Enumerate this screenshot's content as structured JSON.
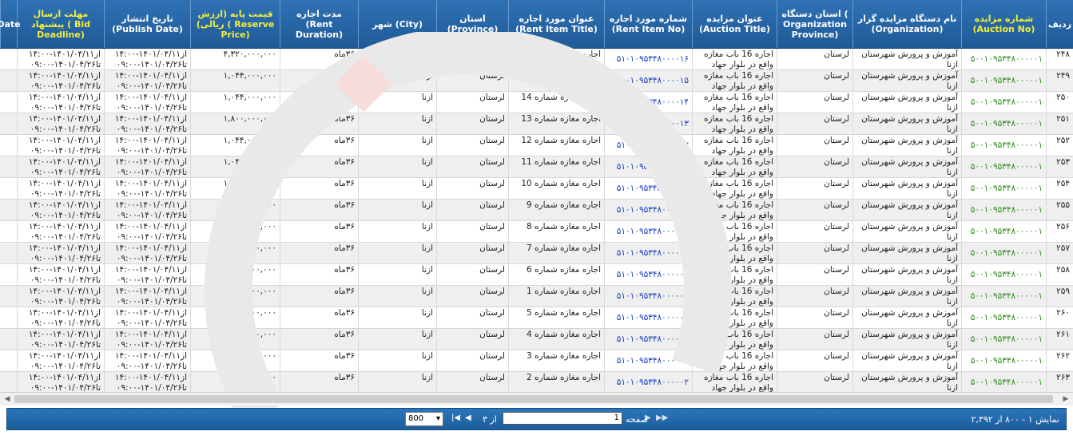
{
  "columns": [
    {
      "key": "row",
      "label": "ردیف"
    },
    {
      "key": "auction_no",
      "label": "شماره مزایده (Auction No)"
    },
    {
      "key": "org",
      "label": "نام دستگاه مزایده گزار (Organization)"
    },
    {
      "key": "org_province",
      "label": "استان دستگاه ( Organization Province)"
    },
    {
      "key": "auction_title",
      "label": "عنوان مزایده (Auction Title)"
    },
    {
      "key": "rent_item_no",
      "label": "شماره مورد اجاره (Rent Item No)"
    },
    {
      "key": "rent_item_title",
      "label": "عنوان مورد اجاره (Rent Item Title)"
    },
    {
      "key": "province",
      "label": "استان (Province)"
    },
    {
      "key": "city",
      "label": "شهر (City)"
    },
    {
      "key": "duration",
      "label": "مدت اجاره (Rent Duration)"
    },
    {
      "key": "price",
      "label": "قیمت پایه (ارزش ریالی) ( Reserve Price)"
    },
    {
      "key": "publish",
      "label": "تاریخ انتشار (Publish Date)"
    },
    {
      "key": "deadline",
      "label": "مهلت ارسال پیشنهاد ( Bid Deadline)"
    },
    {
      "key": "extra",
      "label": "Date"
    }
  ],
  "rows": [
    {
      "row": "۲۴۸",
      "auction_no": "۵۰۰۱۰۹۵۳۴۸۰۰۰۰۰۱",
      "org": "آموزش و پرورش شهرستان ازنا",
      "org_province": "لرستان",
      "auction_title": "اجاره 16 باب مغازه واقع در بلوار جهاد",
      "rent_item_no": "۵۱۰۱۰۹۵۳۴۸۰۰۰۰۱۶",
      "rent_item_title": "اجاره مغازه شماره 16",
      "province": "لرستان",
      "city": "ازنا",
      "duration": "۳۶ماه",
      "price": "۴,۳۲۰,۰۰۰,۰۰۰",
      "publish": "از۱۴۰۱/۰۴/۱۱-۱۴:۰۰ تا۱۴۰۱/۰۴/۲۶-۰۹:۰۰",
      "deadline": "از۱۴۰۱/۰۴/۱۱-۱۴:۰۰ تا۱۴۰۱/۰۴/۲۶-۰۹:۰۰"
    },
    {
      "row": "۲۴۹",
      "auction_no": "۵۰۰۱۰۹۵۳۴۸۰۰۰۰۰۱",
      "org": "آموزش و پرورش شهرستان ازنا",
      "org_province": "لرستان",
      "auction_title": "اجاره 16 باب مغازه واقع در بلوار جهاد",
      "rent_item_no": "۵۱۰۱۰۹۵۳۴۸۰۰۰۰۱۵",
      "rent_item_title": "اجاره مغازه شماره 15",
      "province": "لرستان",
      "city": "ازنا",
      "duration": "۳۶ماه",
      "price": "۱,۰۴۴,۰۰۰,۰۰۰",
      "publish": "از۱۴۰۱/۰۴/۱۱-۱۴:۰۰ تا۱۴۰۱/۰۴/۲۶-۰۹:۰۰",
      "deadline": "از۱۴۰۱/۰۴/۱۱-۱۴:۰۰ تا۱۴۰۱/۰۴/۲۶-۰۹:۰۰"
    },
    {
      "row": "۲۵۰",
      "auction_no": "۵۰۰۱۰۹۵۳۴۸۰۰۰۰۰۱",
      "org": "آموزش و پرورش شهرستان ازنا",
      "org_province": "لرستان",
      "auction_title": "اجاره 16 باب مغازه واقع در بلوار جهاد",
      "rent_item_no": "۵۱۰۱۰۹۵۳۴۸۰۰۰۰۱۴",
      "rent_item_title": "اجاره مغازه شماره 14",
      "province": "لرستان",
      "city": "ازنا",
      "duration": "۳۶ماه",
      "price": "۱,۰۴۴,۰۰۰,۰۰۰",
      "publish": "از۱۴۰۱/۰۴/۱۱-۱۴:۰۰ تا۱۴۰۱/۰۴/۲۶-۰۹:۰۰",
      "deadline": "از۱۴۰۱/۰۴/۱۱-۱۴:۰۰ تا۱۴۰۱/۰۴/۲۶-۰۹:۰۰"
    },
    {
      "row": "۲۵۱",
      "auction_no": "۵۰۰۱۰۹۵۳۴۸۰۰۰۰۰۱",
      "org": "آموزش و پرورش شهرستان ازنا",
      "org_province": "لرستان",
      "auction_title": "اجاره 16 باب مغازه واقع در بلوار جهاد",
      "rent_item_no": "۵۱۰۱۰۹۵۳۴۸۰۰۰۰۱۳",
      "rent_item_title": "اجاره مغازه شماره 13",
      "province": "لرستان",
      "city": "ازنا",
      "duration": "۳۶ماه",
      "price": "۱,۸۰۰,۰۰۰,۰۰۰",
      "publish": "از۱۴۰۱/۰۴/۱۱-۱۴:۰۰ تا۱۴۰۱/۰۴/۲۶-۰۹:۰۰",
      "deadline": "از۱۴۰۱/۰۴/۱۱-۱۴:۰۰ تا۱۴۰۱/۰۴/۲۶-۰۹:۰۰"
    },
    {
      "row": "۲۵۲",
      "auction_no": "۵۰۰۱۰۹۵۳۴۸۰۰۰۰۰۱",
      "org": "آموزش و پرورش شهرستان ازنا",
      "org_province": "لرستان",
      "auction_title": "اجاره 16 باب مغازه واقع در بلوار جهاد",
      "rent_item_no": "۵۱۰۱۰۹۵۳۴۸۰۰۰۰۱۲",
      "rent_item_title": "اجاره مغازه شماره 12",
      "province": "لرستان",
      "city": "ازنا",
      "duration": "۳۶ماه",
      "price": "۱,۰۴۴,۰۰۰,۰۰۰",
      "publish": "از۱۴۰۱/۰۴/۱۱-۱۴:۰۰ تا۱۴۰۱/۰۴/۲۶-۰۹:۰۰",
      "deadline": "از۱۴۰۱/۰۴/۱۱-۱۴:۰۰ تا۱۴۰۱/۰۴/۲۶-۰۹:۰۰"
    },
    {
      "row": "۲۵۳",
      "auction_no": "۵۰۰۱۰۹۵۳۴۸۰۰۰۰۰۱",
      "org": "آموزش و پرورش شهرستان ازنا",
      "org_province": "لرستان",
      "auction_title": "اجاره 16 باب مغازه واقع در بلوار جهاد",
      "rent_item_no": "۵۱۰۱۰۹۵۳۴۸۰۰۰۰۱۱",
      "rent_item_title": "اجاره مغازه شماره 11",
      "province": "لرستان",
      "city": "ازنا",
      "duration": "۳۶ماه",
      "price": "۱,۰۴۴,۰۰۰,۰۰۰",
      "publish": "از۱۴۰۱/۰۴/۱۱-۱۴:۰۰ تا۱۴۰۱/۰۴/۲۶-۰۹:۰۰",
      "deadline": "از۱۴۰۱/۰۴/۱۱-۱۴:۰۰ تا۱۴۰۱/۰۴/۲۶-۰۹:۰۰"
    },
    {
      "row": "۲۵۴",
      "auction_no": "۵۰۰۱۰۹۵۳۴۸۰۰۰۰۰۱",
      "org": "آموزش و پرورش شهرستان ازنا",
      "org_province": "لرستان",
      "auction_title": "اجاره 16 باب مغازه واقع در بلوار جهاد",
      "rent_item_no": "۵۱۰۱۰۹۵۳۴۸۰۰۰۰۱۰",
      "rent_item_title": "اجاره مغازه شماره 10",
      "province": "لرستان",
      "city": "ازنا",
      "duration": "۳۶ماه",
      "price": "۱,۸۰۰,۰۰۰,۰۰۰",
      "publish": "از۱۴۰۱/۰۴/۱۱-۱۴:۰۰ تا۱۴۰۱/۰۴/۲۶-۰۹:۰۰",
      "deadline": "از۱۴۰۱/۰۴/۱۱-۱۴:۰۰ تا۱۴۰۱/۰۴/۲۶-۰۹:۰۰"
    },
    {
      "row": "۲۵۵",
      "auction_no": "۵۰۰۱۰۹۵۳۴۸۰۰۰۰۰۱",
      "org": "آموزش و پرورش شهرستان ازنا",
      "org_province": "لرستان",
      "auction_title": "اجاره 16 باب مغازه واقع در بلوار جهاد",
      "rent_item_no": "۵۱۰۱۰۹۵۳۴۸۰۰۰۰۰۹",
      "rent_item_title": "اجاره مغازه شماره 9",
      "province": "لرستان",
      "city": "ازنا",
      "duration": "۳۶ماه",
      "price": "۱,۰۴۴,۰۰۰,۰۰۰",
      "publish": "از۱۴۰۱/۰۴/۱۱-۱۴:۰۰ تا۱۴۰۱/۰۴/۲۶-۰۹:۰۰",
      "deadline": "از۱۴۰۱/۰۴/۱۱-۱۴:۰۰ تا۱۴۰۱/۰۴/۲۶-۰۹:۰۰"
    },
    {
      "row": "۲۵۶",
      "auction_no": "۵۰۰۱۰۹۵۳۴۸۰۰۰۰۰۱",
      "org": "آموزش و پرورش شهرستان ازنا",
      "org_province": "لرستان",
      "auction_title": "اجاره 16 باب مغازه واقع در بلوار جهاد",
      "rent_item_no": "۵۱۰۱۰۹۵۳۴۸۰۰۰۰۰۸",
      "rent_item_title": "اجاره مغازه شماره 8",
      "province": "لرستان",
      "city": "ازنا",
      "duration": "۳۶ماه",
      "price": "۱,۰۴۴,۰۰۰,۰۰۰",
      "publish": "از۱۴۰۱/۰۴/۱۱-۱۴:۰۰ تا۱۴۰۱/۰۴/۲۶-۰۹:۰۰",
      "deadline": "از۱۴۰۱/۰۴/۱۱-۱۴:۰۰ تا۱۴۰۱/۰۴/۲۶-۰۹:۰۰"
    },
    {
      "row": "۲۵۷",
      "auction_no": "۵۰۰۱۰۹۵۳۴۸۰۰۰۰۰۱",
      "org": "آموزش و پرورش شهرستان ازنا",
      "org_province": "لرستان",
      "auction_title": "اجاره 16 باب مغازه واقع در بلوار جهاد",
      "rent_item_no": "۵۱۰۱۰۹۵۳۴۸۰۰۰۰۰۷",
      "rent_item_title": "اجاره مغازه شماره 7",
      "province": "لرستان",
      "city": "ازنا",
      "duration": "۳۶ماه",
      "price": "۱,۸۰۰,۰۰۰,۰۰۰",
      "publish": "از۱۴۰۱/۰۴/۱۱-۱۴:۰۰ تا۱۴۰۱/۰۴/۲۶-۰۹:۰۰",
      "deadline": "از۱۴۰۱/۰۴/۱۱-۱۴:۰۰ تا۱۴۰۱/۰۴/۲۶-۰۹:۰۰"
    },
    {
      "row": "۲۵۸",
      "auction_no": "۵۰۰۱۰۹۵۳۴۸۰۰۰۰۰۱",
      "org": "آموزش و پرورش شهرستان ازنا",
      "org_province": "لرستان",
      "auction_title": "اجاره 16 باب مغازه واقع در بلوار جهاد",
      "rent_item_no": "۵۱۰۱۰۹۵۳۴۸۰۰۰۰۰۶",
      "rent_item_title": "اجاره مغازه شماره 6",
      "province": "لرستان",
      "city": "ازنا",
      "duration": "۳۶ماه",
      "price": "۱,۰۴۴,۰۰۰,۰۰۰",
      "publish": "از۱۴۰۱/۰۴/۱۱-۱۴:۰۰ تا۱۴۰۱/۰۴/۲۶-۰۹:۰۰",
      "deadline": "از۱۴۰۱/۰۴/۱۱-۱۴:۰۰ تا۱۴۰۱/۰۴/۲۶-۰۹:۰۰"
    },
    {
      "row": "۲۵۹",
      "auction_no": "۵۰۰۱۰۹۵۳۴۸۰۰۰۰۰۱",
      "org": "آموزش و پرورش شهرستان ازنا",
      "org_province": "لرستان",
      "auction_title": "اجاره 16 باب مغازه واقع در بلوار جهاد",
      "rent_item_no": "۵۱۰۱۰۹۵۳۴۸۰۰۰۰۰۱",
      "rent_item_title": "اجاره مغازه شماره 1",
      "province": "لرستان",
      "city": "ازنا",
      "duration": "۳۶ماه",
      "price": "۱,۸۰۰,۰۰۰,۰۰۰",
      "publish": "از۱۴۰۱/۰۴/۱۱-۱۴:۰۰ تا۱۴۰۱/۰۴/۲۶-۰۹:۰۰",
      "deadline": "از۱۴۰۱/۰۴/۱۱-۱۴:۰۰ تا۱۴۰۱/۰۴/۲۶-۰۹:۰۰"
    },
    {
      "row": "۲۶۰",
      "auction_no": "۵۰۰۱۰۹۵۳۴۸۰۰۰۰۰۱",
      "org": "آموزش و پرورش شهرستان ازنا",
      "org_province": "لرستان",
      "auction_title": "اجاره 16 باب مغازه واقع در بلوار جهاد",
      "rent_item_no": "۵۱۰۱۰۹۵۳۴۸۰۰۰۰۰۵",
      "rent_item_title": "اجاره مغازه شماره 5",
      "province": "لرستان",
      "city": "ازنا",
      "duration": "۳۶ماه",
      "price": "۱,۰۴۴,۰۰۰,۰۰۰",
      "publish": "از۱۴۰۱/۰۴/۱۱-۱۴:۰۰ تا۱۴۰۱/۰۴/۲۶-۰۹:۰۰",
      "deadline": "از۱۴۰۱/۰۴/۱۱-۱۴:۰۰ تا۱۴۰۱/۰۴/۲۶-۰۹:۰۰"
    },
    {
      "row": "۲۶۱",
      "auction_no": "۵۰۰۱۰۹۵۳۴۸۰۰۰۰۰۱",
      "org": "آموزش و پرورش شهرستان ازنا",
      "org_province": "لرستان",
      "auction_title": "اجاره 16 باب مغازه واقع در بلوار جهاد",
      "rent_item_no": "۵۱۰۱۰۹۵۳۴۸۰۰۰۰۰۴",
      "rent_item_title": "اجاره مغازه شماره 4",
      "province": "لرستان",
      "city": "ازنا",
      "duration": "۳۶ماه",
      "price": "۱,۸۰۰,۰۰۰,۰۰۰",
      "publish": "از۱۴۰۱/۰۴/۱۱-۱۴:۰۰ تا۱۴۰۱/۰۴/۲۶-۰۹:۰۰",
      "deadline": "از۱۴۰۱/۰۴/۱۱-۱۴:۰۰ تا۱۴۰۱/۰۴/۲۶-۰۹:۰۰"
    },
    {
      "row": "۲۶۲",
      "auction_no": "۵۰۰۱۰۹۵۳۴۸۰۰۰۰۰۱",
      "org": "آموزش و پرورش شهرستان ازنا",
      "org_province": "لرستان",
      "auction_title": "اجاره 16 باب مغازه واقع در بلوار جهاد",
      "rent_item_no": "۵۱۰۱۰۹۵۳۴۸۰۰۰۰۰۳",
      "rent_item_title": "اجاره مغازه شماره 3",
      "province": "لرستان",
      "city": "ازنا",
      "duration": "۳۶ماه",
      "price": "۱,۸۰۰,۰۰۰,۰۰۰",
      "publish": "از۱۴۰۱/۰۴/۱۱-۱۴:۰۰ تا۱۴۰۱/۰۴/۲۶-۰۹:۰۰",
      "deadline": "از۱۴۰۱/۰۴/۱۱-۱۴:۰۰ تا۱۴۰۱/۰۴/۲۶-۰۹:۰۰"
    },
    {
      "row": "۲۶۳",
      "auction_no": "۵۰۰۱۰۹۵۳۴۸۰۰۰۰۰۱",
      "org": "آموزش و پرورش شهرستان ازنا",
      "org_province": "لرستان",
      "auction_title": "اجاره 16 باب مغازه واقع در بلوار جهاد",
      "rent_item_no": "۵۱۰۱۰۹۵۳۴۸۰۰۰۰۰۲",
      "rent_item_title": "اجاره مغازه شماره 2",
      "province": "لرستان",
      "city": "ازنا",
      "duration": "۳۶ماه",
      "price": "۱,۰۴۴,۰۰۰,۰۰۰",
      "publish": "از۱۴۰۱/۰۴/۱۱-۱۴:۰۰ تا۱۴۰۱/۰۴/۲۶-۰۹:۰۰",
      "deadline": "از۱۴۰۱/۰۴/۱۱-۱۴:۰۰ تا۱۴۰۱/۰۴/۲۶-۰۹:۰۰"
    }
  ],
  "pager": {
    "page_label": "صفحه",
    "page_value": "1",
    "of_label": "از ۳",
    "page_size": "800",
    "info": "نمایش ۱ - ۸۰۰ از ۲,۳۹۲"
  },
  "colors": {
    "header_bg": "#2f72b4",
    "link": "#1b3fbf",
    "auction_no": "#2e8b1b",
    "pager_bg": "#1d5d9c"
  },
  "icons": {
    "first_page": "first-page-icon",
    "prev_page": "prev-page-icon",
    "next_page": "next-page-icon",
    "last_page": "last-page-icon"
  }
}
